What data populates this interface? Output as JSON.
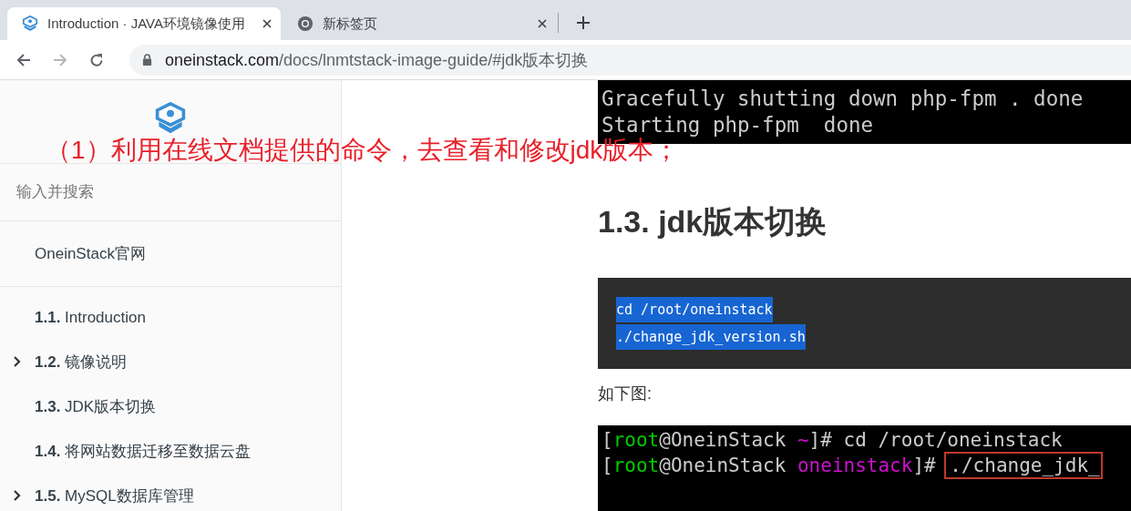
{
  "browser": {
    "tabs": [
      {
        "title": "Introduction · JAVA环境镜像使用",
        "selected": true,
        "kind": "site"
      },
      {
        "title": "新标签页",
        "selected": false,
        "kind": "chrome"
      }
    ],
    "url_host": "oneinstack.com",
    "url_path": "/docs/lnmtstack-image-guide/#jdk版本切换"
  },
  "annotation": "（1）利用在线文档提供的命令，去查看和修改jdk版本；",
  "sidebar": {
    "search": {
      "placeholder": "输入并搜索"
    },
    "home_link": "OneinStack官网",
    "items": [
      {
        "number": "1.1.",
        "label": "Introduction",
        "collapsed": false
      },
      {
        "number": "1.2.",
        "label": "镜像说明",
        "collapsed": true
      },
      {
        "number": "1.3.",
        "label": "JDK版本切换",
        "collapsed": false
      },
      {
        "number": "1.4.",
        "label": "将网站数据迁移至数据云盘",
        "collapsed": false
      },
      {
        "number": "1.5.",
        "label": "MySQL数据库管理",
        "collapsed": true
      }
    ]
  },
  "content": {
    "terminal_top": [
      "Gracefully shutting down php-fpm . done",
      "Starting php-fpm  done"
    ],
    "heading": "1.3. jdk版本切换",
    "code": {
      "lines": [
        "cd /root/oneinstack",
        "./change_jdk_version.sh"
      ],
      "selected": true
    },
    "caption": "如下图:",
    "terminal_bottom": [
      [
        {
          "t": "[",
          "color": "#cccccc"
        },
        {
          "t": "root",
          "color": "#00cc00"
        },
        {
          "t": "@OneinStack ",
          "color": "#cccccc"
        },
        {
          "t": "~",
          "color": "#cc11cc"
        },
        {
          "t": "]# cd /root/oneinstack",
          "color": "#cccccc"
        }
      ],
      [
        {
          "t": "[",
          "color": "#cccccc"
        },
        {
          "t": "root",
          "color": "#00cc00"
        },
        {
          "t": "@OneinStack ",
          "color": "#cccccc"
        },
        {
          "t": "oneinstack",
          "color": "#cc11cc"
        },
        {
          "t": "]# ",
          "color": "#cccccc"
        },
        {
          "t": "./change_jdk_",
          "color": "#cccccc",
          "boxed": true
        }
      ]
    ]
  }
}
